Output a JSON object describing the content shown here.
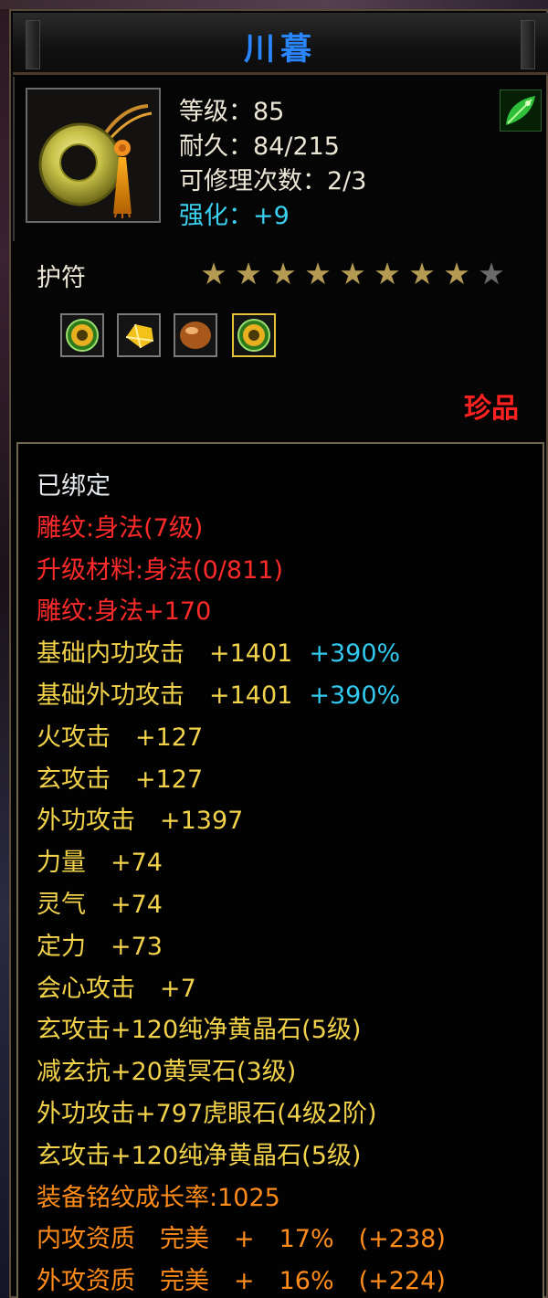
{
  "title": "川暮",
  "colors": {
    "title": "#2a86ff",
    "enhance": "#3ad0f0",
    "rarity": "#ff2020",
    "bound": "#e8ecf0",
    "engraving": "#ff2a2a",
    "base_stat": "#f2d24a",
    "growth": "#ff8c1a",
    "percent": "#31c9f0",
    "star_lit": "#b49a52",
    "star_unlit": "#6a6a6a"
  },
  "item": {
    "icon": "jade-ring-pendant-icon",
    "level": "等级：85",
    "durability": "耐久：84/215",
    "repair_count": "可修理次数：2/3",
    "enhance": "强化：+9",
    "corner_icon": "green-leaf-icon"
  },
  "type": "护符",
  "stars": {
    "total": 9,
    "lit": 8
  },
  "gems": [
    {
      "icon": "green-orb-gem-icon",
      "selected": false
    },
    {
      "icon": "yellow-crystal-gem-icon",
      "selected": false
    },
    {
      "icon": "tiger-eye-gem-icon",
      "selected": false
    },
    {
      "icon": "green-orb-gem-icon",
      "selected": true
    }
  ],
  "rarity": "珍品",
  "stats": [
    {
      "text": "已绑定",
      "color": "white"
    },
    {
      "text": "雕纹:身法(7级)",
      "color": "red"
    },
    {
      "text": "升级材料:身法(0/811)",
      "color": "red"
    },
    {
      "text": "雕纹:身法+170",
      "color": "red"
    },
    {
      "text": "基础内功攻击　+1401",
      "color": "gold",
      "extra": "+390%"
    },
    {
      "text": "基础外功攻击　+1401",
      "color": "gold",
      "extra": "+390%"
    },
    {
      "text": "火攻击　+127",
      "color": "gold"
    },
    {
      "text": "玄攻击　+127",
      "color": "gold"
    },
    {
      "text": "外功攻击　+1397",
      "color": "gold"
    },
    {
      "text": "力量　+74",
      "color": "gold"
    },
    {
      "text": "灵气　+74",
      "color": "gold"
    },
    {
      "text": "定力　+73",
      "color": "gold"
    },
    {
      "text": "会心攻击　+7",
      "color": "gold"
    },
    {
      "text": "玄攻击+120纯净黄晶石(5级)",
      "color": "gold"
    },
    {
      "text": "减玄抗+20黄冥石(3级)",
      "color": "gold"
    },
    {
      "text": "外功攻击+797虎眼石(4级2阶)",
      "color": "gold"
    },
    {
      "text": "玄攻击+120纯净黄晶石(5级)",
      "color": "gold"
    },
    {
      "text": "装备铭纹成长率:1025",
      "color": "orange"
    },
    {
      "text": "内攻资质　完美　+　17%　(+238)",
      "color": "orange"
    },
    {
      "text": "外攻资质　完美　+　16%　(+224)",
      "color": "orange"
    }
  ]
}
